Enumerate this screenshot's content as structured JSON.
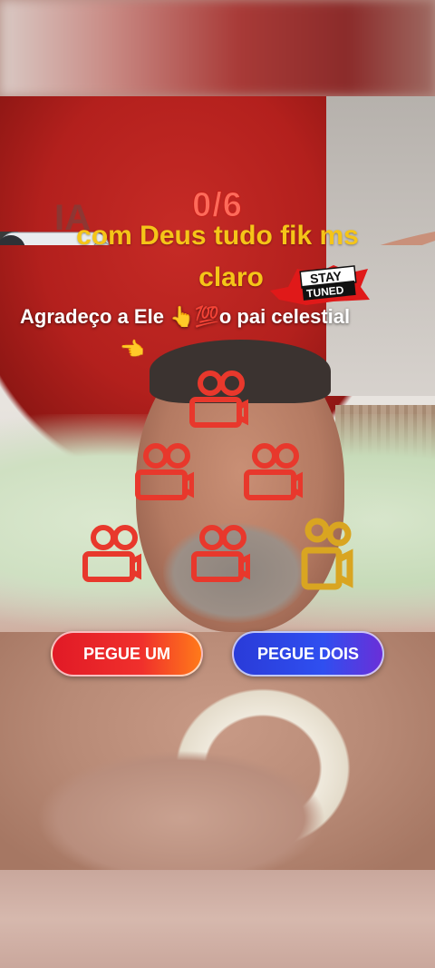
{
  "overlay": {
    "counter": "0/6",
    "caption_line1": "com Deus tudo fik ms",
    "caption_line2": "claro",
    "caption_line3": "Agradeço a Ele 👆💯o pai celestial",
    "caption_emoji": "👈",
    "watermark": "IA",
    "sticker": "STAY TUNED"
  },
  "buttons": {
    "left_label": "PEGUE UM",
    "right_label": "PEGUE DOIS"
  },
  "colors": {
    "counter": "#ff6a5a",
    "caption": "#f5c518",
    "left_button": "#e11a26",
    "right_button": "#2a3bd8",
    "film_icon_red": "#e8382c",
    "film_icon_gold": "#d9a521"
  },
  "icons": [
    "film-camera-icon",
    "robot-hand-icon",
    "human-hand-icon",
    "stay-tuned-sticker"
  ]
}
